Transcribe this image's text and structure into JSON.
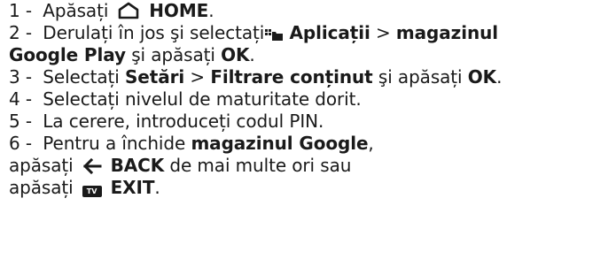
{
  "steps": [
    {
      "number": "1 -",
      "prefix": "Apăsați",
      "icon": "home-icon",
      "button": "HOME",
      "suffix": "."
    },
    {
      "number": "2 -",
      "prefix": "Derulați în jos şi selectați",
      "icon": "apps-icon",
      "bold1": "Aplicații",
      "middle": " > ",
      "bold2": "magazinul",
      "continuation_bold": "Google Play",
      "continuation_text": " şi apăsați ",
      "continuation_bold2": "OK",
      "continuation_end": "."
    },
    {
      "number": "3 -",
      "prefix": "Selectați",
      "bold1": "Setări",
      "middle": " > ",
      "bold2": "Filtrare conținut",
      "text2": " şi apăsați ",
      "bold3": "OK",
      "end": "."
    },
    {
      "number": "4 -",
      "text": "Selectați nivelul de maturitate dorit."
    },
    {
      "number": "5 -",
      "text": "La cerere, introduceți codul PIN."
    },
    {
      "number": "6 -",
      "prefix": "Pentru a închide",
      "bold1": "magazinul Google",
      "end": ",",
      "line2_prefix": "apăsați",
      "line2_icon": "back-arrow-icon",
      "line2_bold": "BACK",
      "line2_text": " de mai multe ori sau",
      "line3_prefix": "apăsați",
      "line3_icon": "tv-icon",
      "line3_icon_text": "TV",
      "line3_bold": "EXIT",
      "line3_end": "."
    }
  ]
}
